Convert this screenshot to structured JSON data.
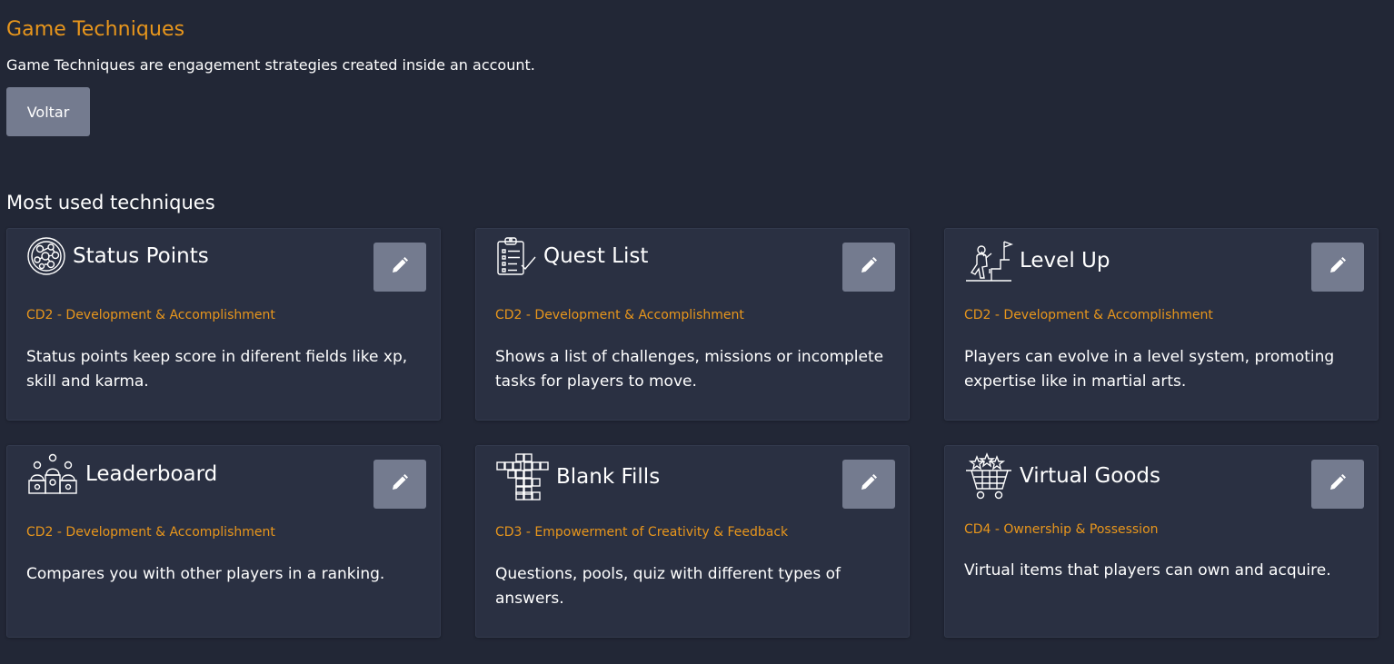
{
  "page": {
    "title": "Game Techniques",
    "subtitle": "Game Techniques are engagement strategies created inside an account.",
    "back_label": "Voltar",
    "section_title": "Most used techniques"
  },
  "colors": {
    "background": "#222736",
    "card": "#2a3042",
    "accent": "#e8961c",
    "button": "#747b8f"
  },
  "cards": [
    {
      "icon": "status-points-icon",
      "title": "Status Points",
      "category": "CD2 - Development & Accomplishment",
      "description": "Status points keep score in diferent fields like xp, skill and karma.",
      "edit_icon": "pencil-icon"
    },
    {
      "icon": "quest-list-icon",
      "title": "Quest List",
      "category": "CD2 - Development & Accomplishment",
      "description": "Shows a list of challenges, missions or incomplete tasks for players to move.",
      "edit_icon": "pencil-icon"
    },
    {
      "icon": "level-up-icon",
      "title": "Level Up",
      "category": "CD2 - Development & Accomplishment",
      "description": "Players can evolve in a level system, promoting expertise like in martial arts.",
      "edit_icon": "pencil-icon"
    },
    {
      "icon": "leaderboard-icon",
      "title": "Leaderboard",
      "category": "CD2 - Development & Accomplishment",
      "description": "Compares you with other players in a ranking.",
      "edit_icon": "pencil-icon"
    },
    {
      "icon": "blank-fills-icon",
      "title": "Blank Fills",
      "category": "CD3 - Empowerment of Creativity & Feedback",
      "description": "Questions, pools, quiz with different types of answers.",
      "edit_icon": "pencil-icon"
    },
    {
      "icon": "virtual-goods-icon",
      "title": "Virtual Goods",
      "category": "CD4 - Ownership & Possession",
      "description": "Virtual items that players can own and acquire.",
      "edit_icon": "pencil-icon"
    }
  ]
}
